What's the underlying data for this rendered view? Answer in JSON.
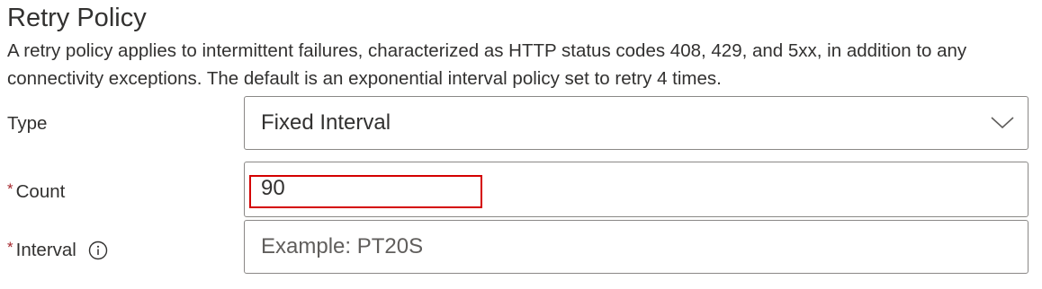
{
  "section": {
    "title": "Retry Policy",
    "description": "A retry policy applies to intermittent failures, characterized as HTTP status codes 408, 429, and 5xx, in addition to any connectivity exceptions. The default is an exponential interval policy set to retry 4 times."
  },
  "fields": {
    "type": {
      "label": "Type",
      "value": "Fixed Interval",
      "icon": "chevron-down-icon"
    },
    "count": {
      "required_marker": "*",
      "label": "Count",
      "value": "90"
    },
    "interval": {
      "required_marker": "*",
      "label": "Interval",
      "value": "",
      "placeholder": "Example: PT20S",
      "icon": "info-icon"
    }
  },
  "colors": {
    "required": "#a4262c",
    "border": "#8a8886",
    "highlight": "#d40000",
    "text": "#323130"
  }
}
